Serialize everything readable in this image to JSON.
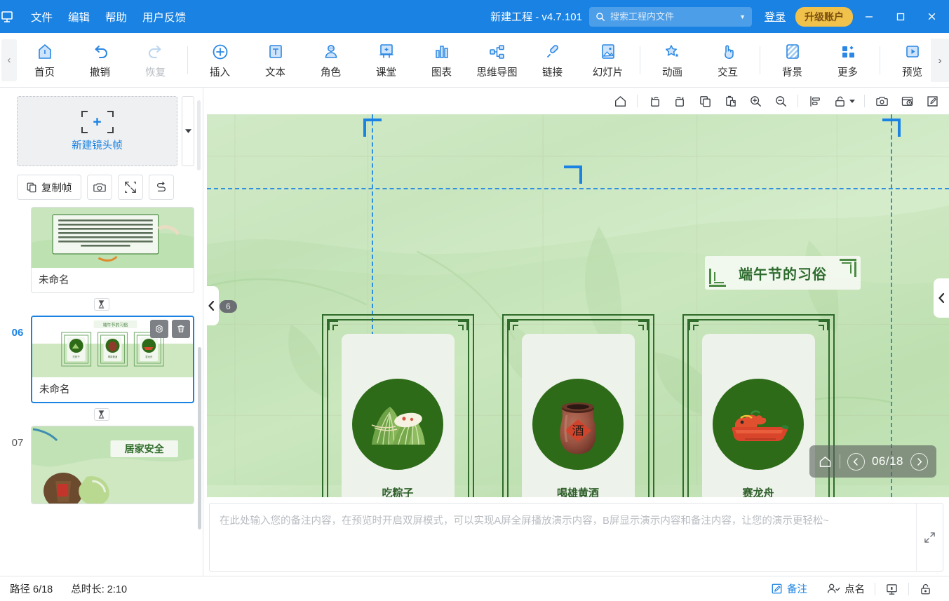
{
  "titlebar": {
    "logo_icon": "app-logo-icon",
    "menus": [
      "文件",
      "编辑",
      "帮助",
      "用户反馈"
    ],
    "project_title": "新建工程 - v4.7.101",
    "search": {
      "placeholder": "搜索工程内文件",
      "value": "",
      "icon": "search-icon",
      "caret": "▼"
    },
    "login_label": "登录",
    "upgrade_label": "升级账户",
    "window_controls": {
      "minimize": "—",
      "maximize": "☐",
      "close": "✕"
    }
  },
  "ribbon": {
    "collapse_left": "‹",
    "expand_right": "›",
    "groups": [
      {
        "items": [
          {
            "label": "首页",
            "icon": "home-icon",
            "disabled": false
          },
          {
            "label": "撤销",
            "icon": "undo-icon",
            "disabled": false
          },
          {
            "label": "恢复",
            "icon": "redo-icon",
            "disabled": true
          }
        ]
      },
      {
        "items": [
          {
            "label": "插入",
            "icon": "plus-circle-icon",
            "disabled": false
          },
          {
            "label": "文本",
            "icon": "text-box-icon",
            "disabled": false
          },
          {
            "label": "角色",
            "icon": "character-icon",
            "disabled": false
          },
          {
            "label": "课堂",
            "icon": "classroom-icon",
            "disabled": false
          },
          {
            "label": "图表",
            "icon": "bar-chart-icon",
            "disabled": false
          },
          {
            "label": "思维导图",
            "icon": "mindmap-icon",
            "disabled": false
          },
          {
            "label": "链接",
            "icon": "link-icon",
            "disabled": false
          },
          {
            "label": "幻灯片",
            "icon": "slide-icon",
            "disabled": false
          }
        ]
      },
      {
        "items": [
          {
            "label": "动画",
            "icon": "animation-star-icon",
            "disabled": false
          },
          {
            "label": "交互",
            "icon": "interaction-hand-icon",
            "disabled": false
          }
        ]
      },
      {
        "items": [
          {
            "label": "背景",
            "icon": "background-icon",
            "disabled": false
          },
          {
            "label": "更多",
            "icon": "more-grid-icon",
            "disabled": false
          }
        ]
      },
      {
        "items": [
          {
            "label": "预览",
            "icon": "preview-play-icon",
            "disabled": false
          }
        ]
      }
    ]
  },
  "slides_panel": {
    "new_frame_label": "新建镜头帧",
    "new_frame_dropdown_icon": "chevron-down-icon",
    "tools": [
      {
        "label": "复制帧",
        "icon": "copy-frame-icon"
      },
      {
        "label": "",
        "icon": "camera-icon"
      },
      {
        "label": "",
        "icon": "fit-frame-icon"
      },
      {
        "label": "",
        "icon": "path-reorder-icon"
      }
    ],
    "transition_icon": "transition-hourglass-icon",
    "slides": [
      {
        "number": "",
        "name": "未命名",
        "active": false,
        "type": "text-slide"
      },
      {
        "number": "06",
        "name": "未命名",
        "active": true,
        "type": "customs-slide",
        "hover_actions": [
          {
            "icon": "preview-eye-icon"
          },
          {
            "icon": "delete-trash-icon"
          }
        ]
      },
      {
        "number": "07",
        "name": "",
        "active": false,
        "type": "safety-slide",
        "thumb_title": "居家安全"
      }
    ]
  },
  "canvas_toolbar": {
    "buttons": [
      {
        "icon": "home-icon",
        "name": "fit-home"
      },
      {
        "icon": "rotate-left-icon",
        "name": "rotate-left"
      },
      {
        "icon": "rotate-right-icon",
        "name": "rotate-right"
      },
      {
        "icon": "copy-icon",
        "name": "copy"
      },
      {
        "icon": "paste-icon",
        "name": "paste"
      },
      {
        "icon": "zoom-in-icon",
        "name": "zoom-in"
      },
      {
        "icon": "zoom-out-icon",
        "name": "zoom-out"
      },
      {
        "icon": "align-icon",
        "name": "align"
      },
      {
        "icon": "unlock-icon",
        "name": "lock",
        "has_caret": true
      },
      {
        "icon": "screenshot-icon",
        "name": "screenshot"
      },
      {
        "icon": "record-icon",
        "name": "record"
      },
      {
        "icon": "edit-icon",
        "name": "edit"
      }
    ]
  },
  "stage": {
    "frame_badge": "6",
    "banner_title": "端午节的习俗",
    "cards": [
      {
        "label": "吃粽子",
        "art": "zongzi-icon"
      },
      {
        "label": "喝雄黄酒",
        "art": "wine-jar-icon",
        "jar_char": "酒"
      },
      {
        "label": "赛龙舟",
        "art": "dragon-boat-icon"
      }
    ],
    "nav_overlay": {
      "home_icon": "home-icon",
      "prev_icon": "chevron-left-icon",
      "next_icon": "chevron-right-icon",
      "counter": "06/18"
    },
    "left_tab_icon": "chevron-left-icon",
    "right_tab_icon": "chevron-left-icon"
  },
  "notes": {
    "placeholder": "在此处输入您的备注内容，在预览时开启双屏模式，可以实现A屏全屏播放演示内容，B屏显示演示内容和备注内容，让您的演示更轻松~",
    "value": "",
    "expand_icon": "expand-diagonal-icon"
  },
  "statusbar": {
    "path_label": "路径 6/18",
    "duration_label": "总时长: 2:10",
    "buttons": [
      {
        "label": "备注",
        "icon": "note-edit-icon",
        "accent": true
      },
      {
        "label": "点名",
        "icon": "roll-call-icon",
        "accent": false
      },
      {
        "label": "",
        "icon": "present-screen-icon",
        "accent": false
      },
      {
        "label": "",
        "icon": "lock-open-icon",
        "accent": false
      }
    ]
  },
  "colors": {
    "brand_blue": "#1a82e2",
    "upgrade_gold": "#f0c14b",
    "stage_green": "#bfe1b4",
    "frame_green": "#2f6b2a",
    "circle_green": "#2d6b18"
  }
}
